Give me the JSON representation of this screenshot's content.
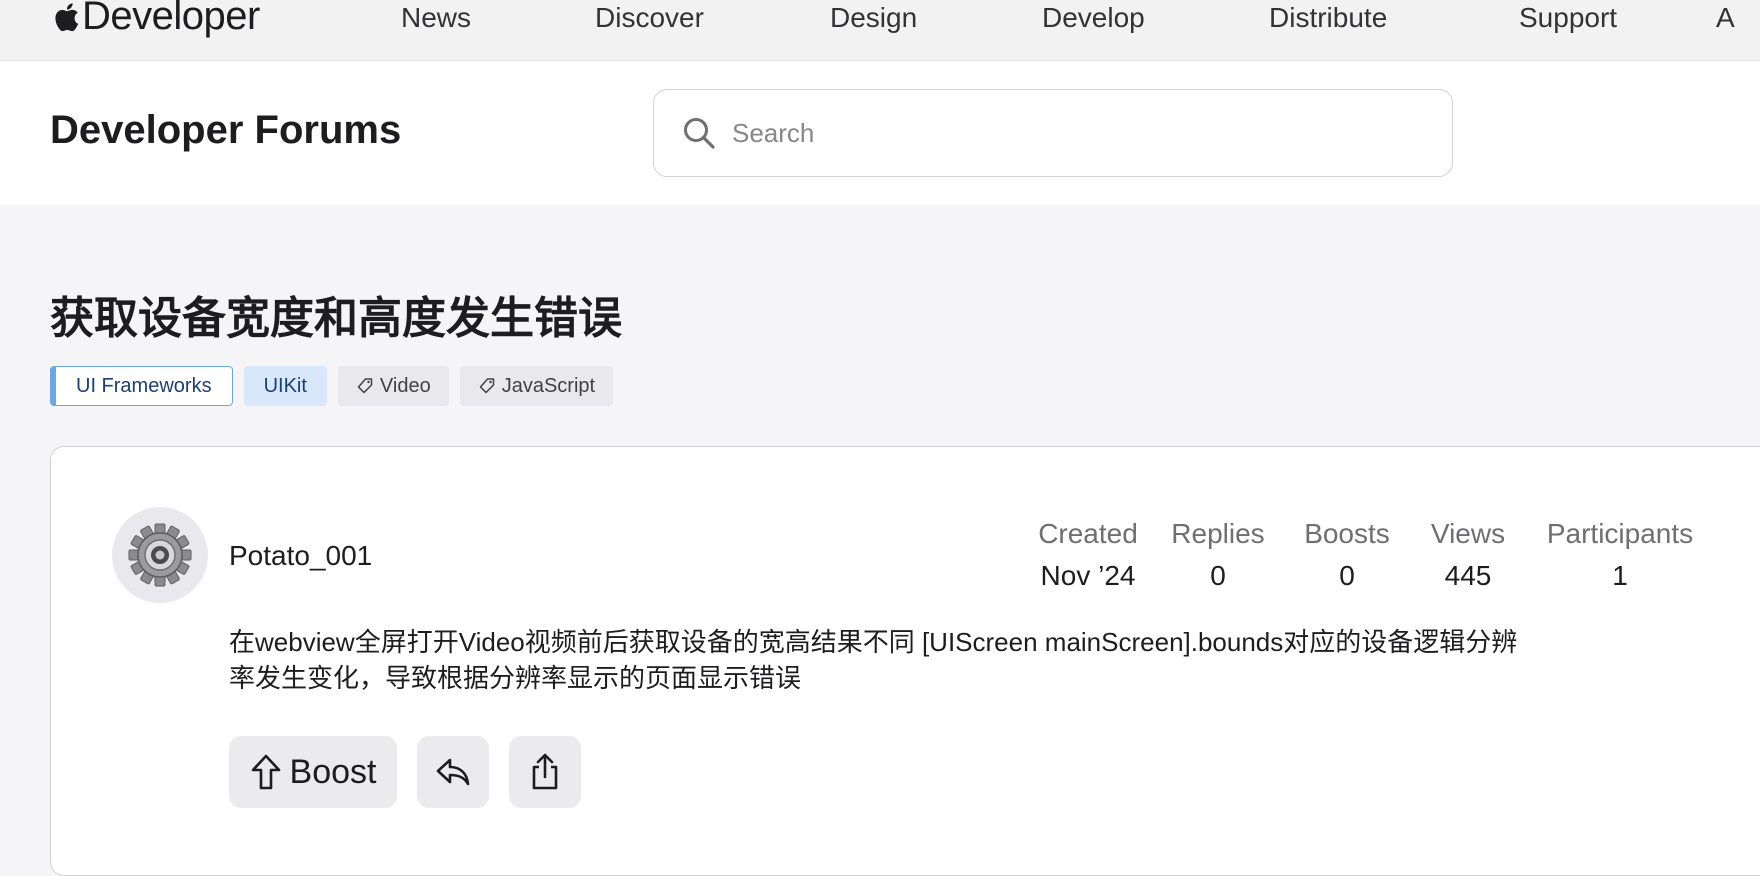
{
  "nav": {
    "brand": "Developer",
    "items": [
      "News",
      "Discover",
      "Design",
      "Develop",
      "Distribute",
      "Support",
      "A"
    ]
  },
  "header": {
    "title": "Developer Forums",
    "search_placeholder": "Search"
  },
  "thread": {
    "title": "获取设备宽度和高度发生错误",
    "tags": [
      {
        "label": "UI Frameworks",
        "kind": "framework"
      },
      {
        "label": "UIKit",
        "kind": "subframework"
      },
      {
        "label": "Video",
        "kind": "tag"
      },
      {
        "label": "JavaScript",
        "kind": "tag"
      }
    ]
  },
  "post": {
    "author": "Potato_001",
    "avatar_icon": "gear-avatar-icon",
    "stats": [
      {
        "label": "Created",
        "value": "Nov ’24"
      },
      {
        "label": "Replies",
        "value": "0"
      },
      {
        "label": "Boosts",
        "value": "0"
      },
      {
        "label": "Views",
        "value": "445"
      },
      {
        "label": "Participants",
        "value": "1"
      }
    ],
    "body_line1": "在webview全屏打开Video视频前后获取设备的宽高结果不同 [UIScreen mainScreen].bounds对应的设备逻辑分辨",
    "body_line2": "率发生变化，导致根据分辨率显示的页面显示错误",
    "actions": {
      "boost_label": "Boost",
      "reply_icon": "reply-icon",
      "share_icon": "share-icon"
    }
  }
}
